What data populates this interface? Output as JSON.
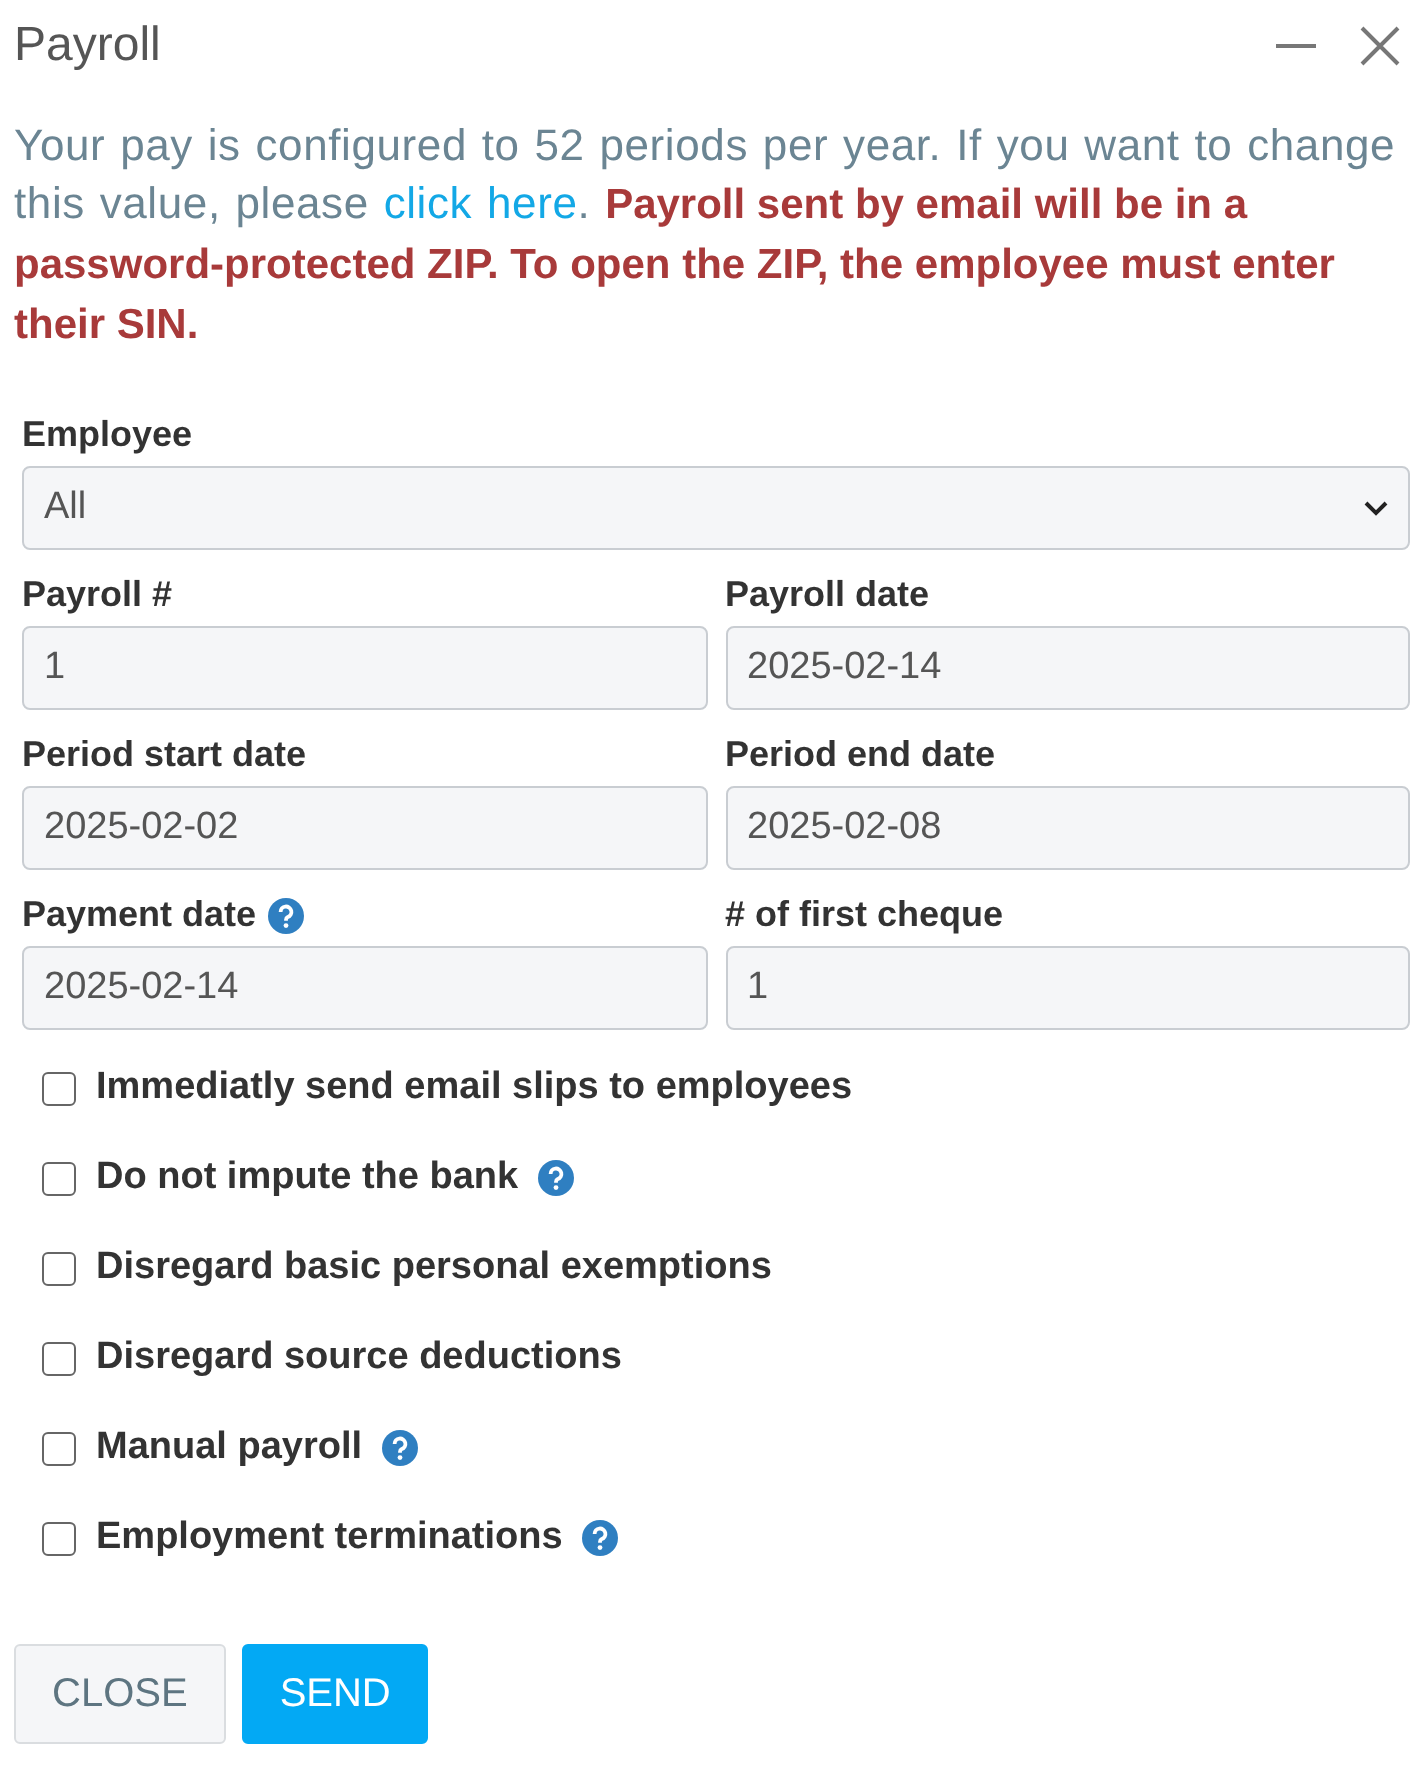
{
  "window": {
    "title": "Payroll",
    "controls": [
      {
        "kind": "minimize"
      },
      {
        "kind": "close"
      }
    ]
  },
  "notice": {
    "before": "Your pay is configured to 52 periods per year. If you want to change this value, please ",
    "link": "click here",
    "after": ". **Payroll sent by email will be in a password-protected ZIP. To open the ZIP, the employee must enter their SIN.**"
  },
  "employee": {
    "label": "Employee",
    "value": "All"
  },
  "fields": [
    {
      "label": "Payroll #",
      "value": "1",
      "help": false
    },
    {
      "label": "Payroll date",
      "value": "2025-02-14",
      "help": false
    },
    {
      "label": "Period start date",
      "value": "2025-02-02",
      "help": false
    },
    {
      "label": "Period end date",
      "value": "2025-02-08",
      "help": false
    },
    {
      "label": "Payment date",
      "value": "2025-02-14",
      "help": true
    },
    {
      "label": "# of first cheque",
      "value": "1",
      "help": false
    }
  ],
  "options": [
    {
      "label": "Immediatly send email slips to employees",
      "checked": false,
      "help": false
    },
    {
      "label": "Do not impute the bank",
      "checked": false,
      "help": true
    },
    {
      "label": "Disregard basic personal exemptions",
      "checked": false,
      "help": false
    },
    {
      "label": "Disregard source deductions",
      "checked": false,
      "help": false
    },
    {
      "label": "Manual payroll",
      "checked": false,
      "help": true
    },
    {
      "label": "Employment terminations",
      "checked": false,
      "help": true
    }
  ],
  "buttons": [
    {
      "label": "CLOSE",
      "kind": "secondary"
    },
    {
      "label": "SEND",
      "kind": "primary"
    }
  ]
}
